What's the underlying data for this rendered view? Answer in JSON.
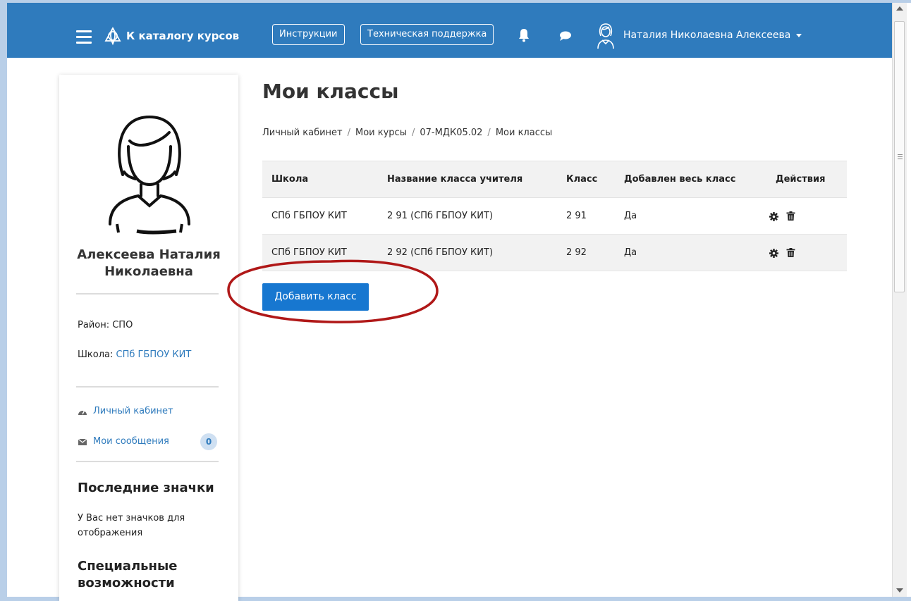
{
  "navbar": {
    "catalog_link": "К каталогу курсов",
    "instructions_button": "Инструкции",
    "support_button": "Техническая поддержка",
    "user_name": "Наталия Николаевна Алексеева",
    "icons": [
      "menu-icon",
      "logo-icon",
      "bell-icon",
      "chat-icon",
      "user-avatar-icon",
      "caret-down-icon"
    ],
    "color": "#2f7bbd"
  },
  "sidebar": {
    "profile_name_line1": "Алексеева Наталия",
    "profile_name_line2": "Николаевна",
    "district_label": "Район: СПО",
    "school_label": "Школа: ",
    "school_value": "СПб ГБПОУ КИТ",
    "dashboard_link": "Личный кабинет",
    "messages_link": "Мои сообщения",
    "messages_count": "0",
    "badges_heading": "Последние значки",
    "badges_empty_line1": "У Вас нет значков для",
    "badges_empty_line2": "отображения",
    "accessibility_heading_line1": "Специальные",
    "accessibility_heading_line2": "возможности"
  },
  "main": {
    "title": "Мои классы",
    "breadcrumb": [
      "Личный кабинет",
      "Мои курсы",
      "07-МДК05.02",
      "Мои классы"
    ],
    "table": {
      "headers": [
        "Школа",
        "Название класса учителя",
        "Класс",
        "Добавлен весь класс",
        "Действия"
      ],
      "rows": [
        [
          "СПб ГБПОУ КИТ",
          "2 91 (СПб ГБПОУ КИТ)",
          "2 91",
          "Да"
        ],
        [
          "СПб ГБПОУ КИТ",
          "2 92 (СПб ГБПОУ КИТ)",
          "2 92",
          "Да"
        ]
      ],
      "action_icons": [
        "gear-icon",
        "trash-icon"
      ]
    },
    "add_class_button": "Добавить класс",
    "annotation_color": "#b01818",
    "button_color": "#1777d0"
  }
}
